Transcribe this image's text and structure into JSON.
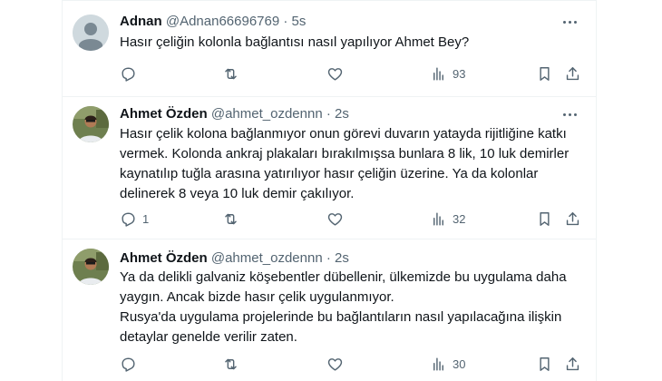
{
  "tweets": [
    {
      "name": "Adnan",
      "handle": "@Adnan66696769",
      "dot": "·",
      "time": "5s",
      "lines": [
        "Hasır çeliğin kolonla bağlantısı nasıl yapılıyor  Ahmet  Bey?"
      ],
      "reply_count": "",
      "retweet_count": "",
      "like_count": "",
      "view_count": "93",
      "avatar": "default-avatar"
    },
    {
      "name": "Ahmet Özden",
      "handle": "@ahmet_ozdennn",
      "dot": "·",
      "time": "2s",
      "lines": [
        "Hasır çelik kolona bağlanmıyor onun görevi duvarın yatayda rijitliğine katkı",
        "vermek. Kolonda ankraj plakaları bırakılmışsa bunlara 8 lik, 10 luk demirler",
        "kaynatılıp tuğla arasına yatırılıyor hasır çeliğin üzerine. Ya da kolonlar",
        "delinerek 8 veya 10 luk demir çakılıyor."
      ],
      "reply_count": "1",
      "retweet_count": "",
      "like_count": "",
      "view_count": "32",
      "avatar": "photo-avatar"
    },
    {
      "name": "Ahmet Özden",
      "handle": "@ahmet_ozdennn",
      "dot": "·",
      "time": "2s",
      "lines": [
        "Ya da delikli galvaniz köşebentler dübellenir, ülkemizde bu uygulama daha",
        "yaygın. Ancak bizde hasır çelik uygulanmıyor.",
        "Rusya'da uygulama projelerinde bu bağlantıların nasıl yapılacağına ilişkin",
        "detaylar genelde verilir zaten."
      ],
      "reply_count": "",
      "retweet_count": "",
      "like_count": "",
      "view_count": "30",
      "avatar": "photo-avatar"
    }
  ],
  "colors": {
    "text": "#0f1419",
    "muted": "#536471",
    "border": "#eff3f4",
    "background": "#ffffff"
  },
  "icons": [
    "reply-icon",
    "retweet-icon",
    "like-icon",
    "views-icon",
    "bookmark-icon",
    "share-icon",
    "more-icon"
  ]
}
